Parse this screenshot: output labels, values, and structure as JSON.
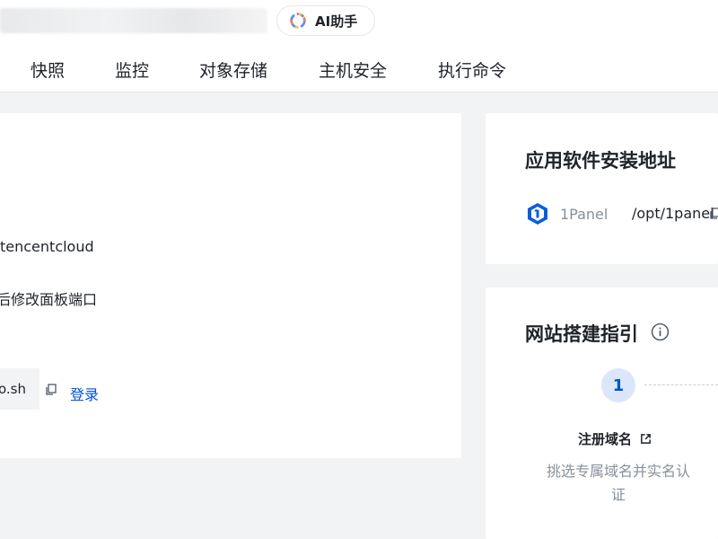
{
  "header": {
    "ai_button_label": "AI助手"
  },
  "tabs": [
    {
      "label": "快照"
    },
    {
      "label": "监控"
    },
    {
      "label": "对象存储"
    },
    {
      "label": "主机安全"
    },
    {
      "label": "执行命令"
    }
  ],
  "main_card": {
    "line_user": "tencentcloud",
    "line_note": "后修改面板端口",
    "code_text": "o.sh",
    "login_link": "登录"
  },
  "install_card": {
    "title": "应用软件安装地址",
    "app_name": "1Panel",
    "app_path": "/opt/1panel"
  },
  "guide_card": {
    "title": "网站搭建指引",
    "step_number": "1",
    "step_title": "注册域名",
    "step_desc": "挑选专属域名并实名认证"
  },
  "colors": {
    "primary": "#0052d9",
    "step_bg": "#dbe6fb",
    "muted_text": "#86909c",
    "page_bg": "#f2f3f5"
  },
  "icons": {
    "ai": "ai-assistant-icon",
    "copy": "copy-icon",
    "external": "external-link-icon",
    "info": "info-icon",
    "app": "1panel-logo-icon"
  }
}
